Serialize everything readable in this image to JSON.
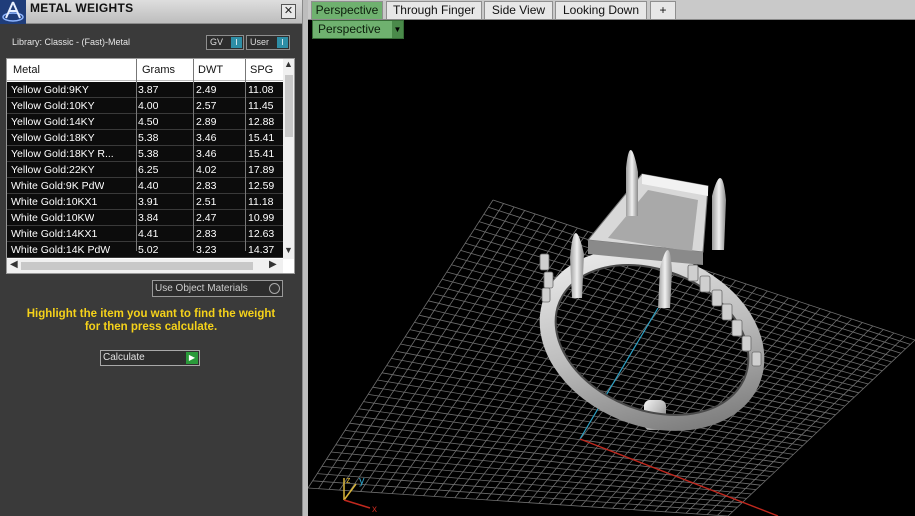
{
  "panel": {
    "title": "METAL WEIGHTS",
    "close_label": "✕",
    "library_label": "Library: Classic - (Fast)-Metal",
    "toggles": [
      {
        "label": "GV",
        "knob": "I"
      },
      {
        "label": "User",
        "knob": "I"
      }
    ],
    "table": {
      "columns": [
        "Metal",
        "Grams",
        "DWT",
        "SPG"
      ],
      "rows": [
        [
          "Yellow Gold:9KY",
          "3.87",
          "2.49",
          "11.08"
        ],
        [
          "Yellow Gold:10KY",
          "4.00",
          "2.57",
          "11.45"
        ],
        [
          "Yellow Gold:14KY",
          "4.50",
          "2.89",
          "12.88"
        ],
        [
          "Yellow Gold:18KY",
          "5.38",
          "3.46",
          "15.41"
        ],
        [
          "Yellow Gold:18KY R...",
          "5.38",
          "3.46",
          "15.41"
        ],
        [
          "Yellow Gold:22KY",
          "6.25",
          "4.02",
          "17.89"
        ],
        [
          "White Gold:9K PdW",
          "4.40",
          "2.83",
          "12.59"
        ],
        [
          "White Gold:10KX1",
          "3.91",
          "2.51",
          "11.18"
        ],
        [
          "White Gold:10KW",
          "3.84",
          "2.47",
          "10.99"
        ],
        [
          "White Gold:14KX1",
          "4.41",
          "2.83",
          "12.63"
        ],
        [
          "White Gold:14K PdW",
          "5.02",
          "3.23",
          "14.37"
        ]
      ]
    },
    "use_object_materials_label": "Use Object Materials",
    "hint_line1": "Highlight the item you want to find the weight",
    "hint_line2": "for then press calculate.",
    "calculate_label": "Calculate"
  },
  "viewport": {
    "tabs": [
      "Perspective",
      "Through Finger",
      "Side View",
      "Looking Down"
    ],
    "active_tab": "Perspective",
    "add_tab_label": "+",
    "view_select": "Perspective",
    "axis_labels": {
      "x": "x",
      "y": "y",
      "z": "z"
    }
  },
  "colors": {
    "active_tab": "#6fb16f",
    "hint_text": "#f5d21a",
    "grid": "#6e6e6e",
    "x_axis": "#c0281e",
    "y_axis": "#2ea3c7"
  }
}
